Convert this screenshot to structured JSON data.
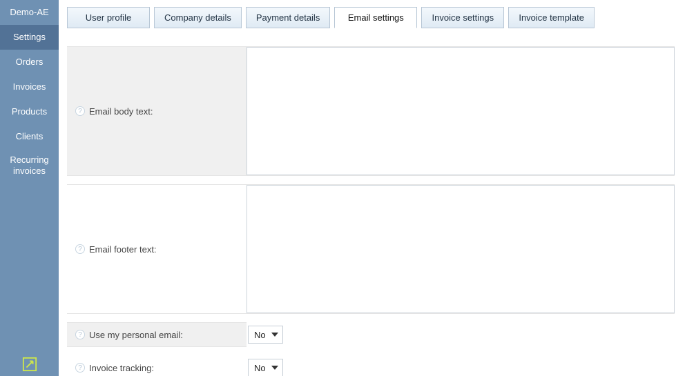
{
  "sidebar": {
    "brand": "Demo-AE",
    "items": [
      {
        "label": "Settings",
        "active": true
      },
      {
        "label": "Orders"
      },
      {
        "label": "Invoices"
      },
      {
        "label": "Products"
      },
      {
        "label": "Clients"
      },
      {
        "label": "Recurring invoices"
      }
    ]
  },
  "tabs": [
    {
      "label": "User profile"
    },
    {
      "label": "Company details"
    },
    {
      "label": "Payment details"
    },
    {
      "label": "Email settings",
      "active": true
    },
    {
      "label": "Invoice settings"
    },
    {
      "label": "Invoice template"
    }
  ],
  "form": {
    "email_body_label": "Email body text:",
    "email_body_value": "",
    "email_footer_label": "Email footer text:",
    "email_footer_value": "",
    "personal_email_label": "Use my personal email:",
    "personal_email_value": "No",
    "invoice_tracking_label": "Invoice tracking:",
    "invoice_tracking_value": "No"
  }
}
